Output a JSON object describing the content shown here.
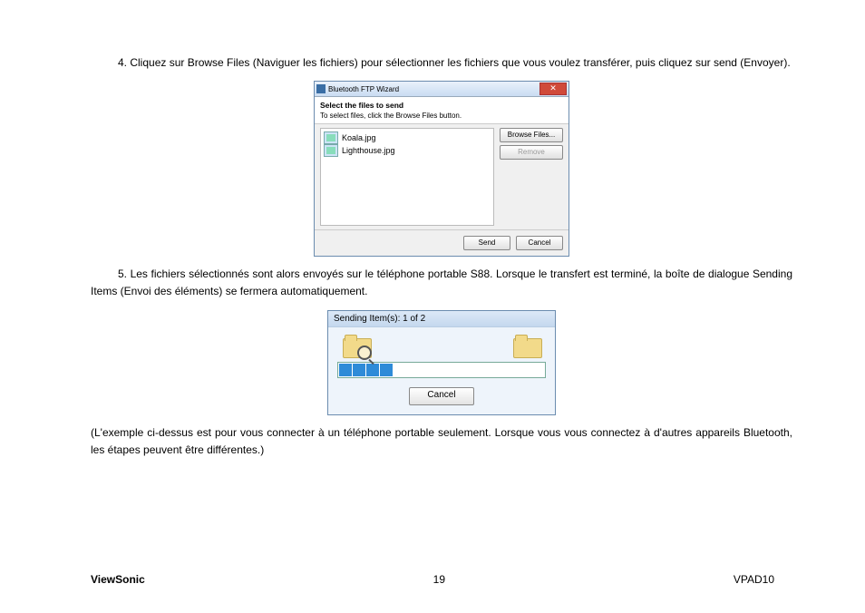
{
  "step4_text": "4. Cliquez sur Browse Files (Naviguer les fichiers) pour sélectionner les fichiers que vous voulez transférer, puis cliquez sur send (Envoyer).",
  "wizard": {
    "title": "Bluetooth FTP Wizard",
    "band_head": "Select the files to send",
    "band_sub": "To select files, click the Browse Files button.",
    "file1": "Koala.jpg",
    "file2": "Lighthouse.jpg",
    "browse_btn": "Browse Files...",
    "remove_btn": "Remove",
    "send_btn": "Send",
    "cancel_btn": "Cancel"
  },
  "step5_text": "5. Les fichiers sélectionnés sont alors envoyés sur le téléphone portable S88. Lorsque le transfert est terminé, la boîte de dialogue Sending Items (Envoi des éléments) se fermera automatiquement.",
  "sending": {
    "title": "Sending Item(s): 1 of 2",
    "cancel_btn": "Cancel"
  },
  "note_text": "(L'exemple ci-dessus est pour vous connecter à un téléphone portable seulement. Lorsque vous vous connectez à d'autres appareils Bluetooth, les étapes peuvent être différentes.)",
  "footer": {
    "brand": "ViewSonic",
    "page": "19",
    "model": "VPAD10"
  }
}
